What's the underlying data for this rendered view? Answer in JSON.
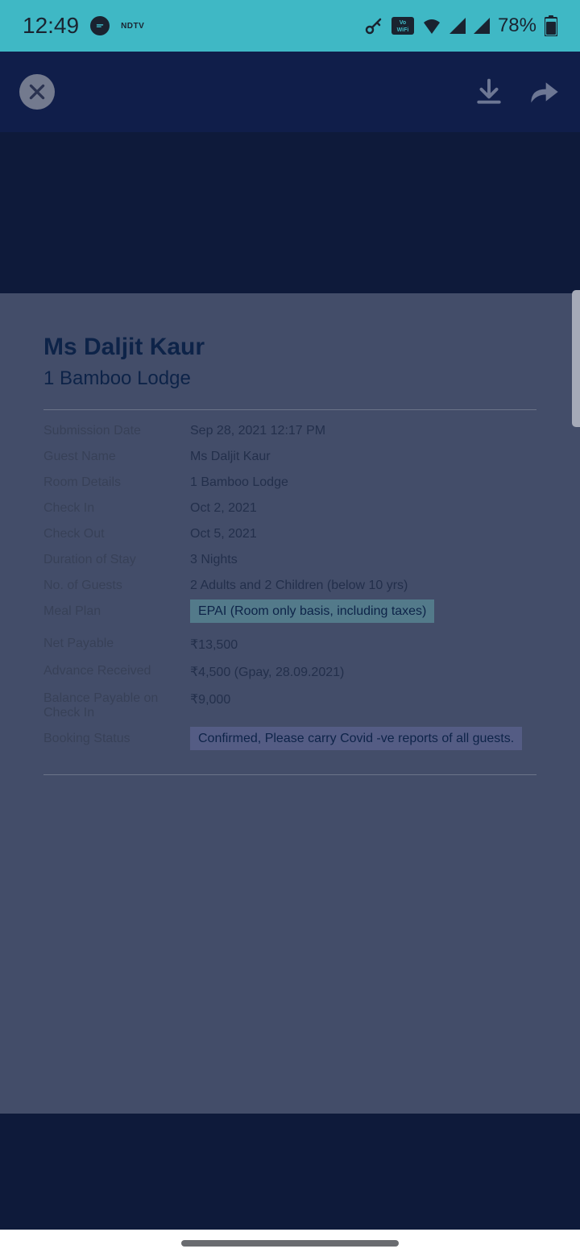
{
  "status": {
    "time": "12:49",
    "ndtv": "NDTV",
    "battery_pct": "78%"
  },
  "doc": {
    "title": "Ms Daljit Kaur",
    "subtitle": "1 Bamboo Lodge",
    "fields": {
      "submission_date": {
        "label": "Submission Date",
        "value": "Sep 28, 2021 12:17 PM"
      },
      "guest_name": {
        "label": "Guest Name",
        "value": "Ms Daljit Kaur"
      },
      "room_details": {
        "label": "Room Details",
        "value": "1 Bamboo Lodge"
      },
      "check_in": {
        "label": "Check In",
        "value": "Oct 2, 2021"
      },
      "check_out": {
        "label": "Check Out",
        "value": "Oct 5, 2021"
      },
      "duration": {
        "label": "Duration of Stay",
        "value": "3 Nights"
      },
      "guests": {
        "label": "No. of Guests",
        "value": "2 Adults and 2 Children (below 10 yrs)"
      },
      "meal_plan": {
        "label": "Meal Plan",
        "value": "EPAI (Room only basis, including taxes)"
      },
      "net_payable": {
        "label": "Net Payable",
        "value": "₹13,500"
      },
      "advance": {
        "label": "Advance Received",
        "value": "₹4,500 (Gpay, 28.09.2021)"
      },
      "balance": {
        "label": "Balance Payable on Check In",
        "value": "₹9,000"
      },
      "status": {
        "label": "Booking Status",
        "value": "Confirmed, Please carry Covid -ve reports of all guests."
      }
    }
  }
}
